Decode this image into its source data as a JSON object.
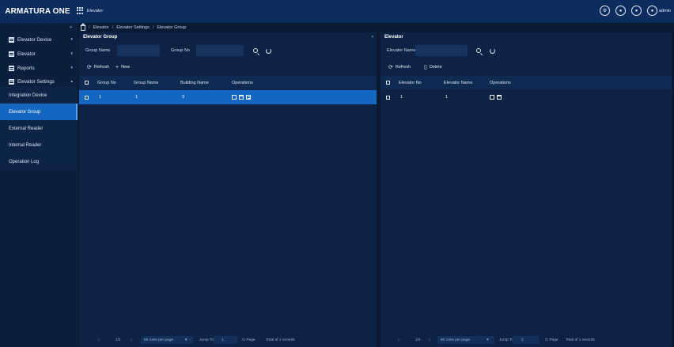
{
  "app": {
    "logo": "ARMATURA ONE",
    "module_label": "Elevator",
    "user_label": "admin"
  },
  "header_icons": [
    "settings-icon",
    "notification-icon",
    "help-icon",
    "user-icon"
  ],
  "sidebar": {
    "collapse_glyph": "«",
    "items": [
      {
        "label": "Elevator Device",
        "icon": "device-icon"
      },
      {
        "label": "Elevator",
        "icon": "elevator-icon"
      },
      {
        "label": "Reports",
        "icon": "reports-icon"
      },
      {
        "label": "Elevator Settings",
        "icon": "settings-icon"
      }
    ],
    "sub_items": [
      {
        "label": "Integration Device",
        "active": false
      },
      {
        "label": "Elevator Group",
        "active": true
      },
      {
        "label": "External Reader",
        "active": false
      },
      {
        "label": "Internal Reader",
        "active": false
      },
      {
        "label": "Operation Log",
        "active": false
      }
    ]
  },
  "breadcrumb": [
    "Elevator",
    "Elevator Settings",
    "Elevator Group"
  ],
  "left_panel": {
    "title": "Elevator Group",
    "filters": [
      {
        "label": "Group Name",
        "value": ""
      },
      {
        "label": "Group No",
        "value": ""
      }
    ],
    "toolbar": {
      "refresh": "Refresh",
      "new": "New"
    },
    "columns": [
      "Group No",
      "Group Name",
      "Building Name",
      "Operations"
    ],
    "rows": [
      {
        "group_no": "1",
        "group_name": "1",
        "building_name": "3"
      }
    ],
    "pager": {
      "page": "1/1",
      "rows_per_page": "50 rows per page",
      "jump_to": "Jump To",
      "jump_value": "1",
      "page_suffix": "/1 Page",
      "total": "Total of 1 records"
    }
  },
  "right_panel": {
    "title": "Elevator",
    "filters": [
      {
        "label": "Elevator Name",
        "value": ""
      }
    ],
    "toolbar": {
      "refresh": "Refresh",
      "delete": "Delete"
    },
    "columns": [
      "Elevator No",
      "Elevator Name",
      "Operations"
    ],
    "rows": [
      {
        "elevator_no": "1",
        "elevator_name": "1"
      }
    ],
    "pager": {
      "page": "1/1",
      "rows_per_page": "50 rows per page",
      "jump_to": "Jump To",
      "jump_value": "1",
      "page_suffix": "/1 Page",
      "total": "Total of 1 records"
    }
  },
  "colors": {
    "topbar": "#0d2c5e",
    "panel": "#0d2245",
    "accent": "#1466c0"
  }
}
